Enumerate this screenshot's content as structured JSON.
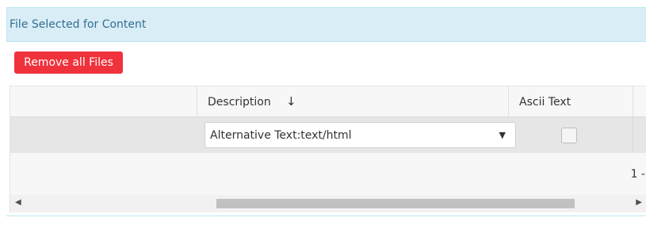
{
  "panel": {
    "title": "File Selected for Content"
  },
  "toolbar": {
    "remove_all_label": "Remove all Files"
  },
  "grid": {
    "columns": [
      {
        "label": ""
      },
      {
        "label": "Description",
        "sort_icon": "↓"
      },
      {
        "label": "Ascii Text"
      }
    ],
    "rows": [
      {
        "description_value": "Alternative Text:text/html",
        "ascii_text_checked": false
      }
    ],
    "pager_info": "1 -"
  },
  "colors": {
    "remove_button": "#f0323c",
    "panel_header_bg": "#d9edf7",
    "panel_title": "#31708f"
  },
  "icons": {
    "select_arrow": "chevron-down-icon",
    "scroll_left": "scroll-left-icon",
    "scroll_right": "scroll-right-icon",
    "sort": "sort-down-icon"
  }
}
